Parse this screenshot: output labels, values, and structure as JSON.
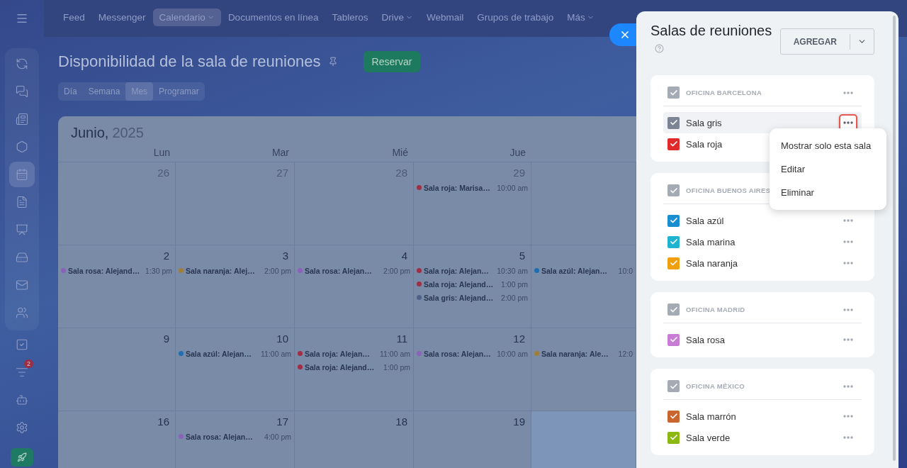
{
  "nav": {
    "items": [
      {
        "label": "Feed",
        "selected": false,
        "caret": false
      },
      {
        "label": "Messenger",
        "selected": false,
        "caret": false
      },
      {
        "label": "Calendario",
        "selected": true,
        "caret": true
      },
      {
        "label": "Documentos en línea",
        "selected": false,
        "caret": false
      },
      {
        "label": "Tableros",
        "selected": false,
        "caret": false
      },
      {
        "label": "Drive",
        "selected": false,
        "caret": true
      },
      {
        "label": "Webmail",
        "selected": false,
        "caret": false
      },
      {
        "label": "Grupos de trabajo",
        "selected": false,
        "caret": false
      },
      {
        "label": "Más",
        "selected": false,
        "caret": true
      }
    ]
  },
  "sidebar": {
    "grouped_items": [
      {
        "selected": false
      },
      {
        "selected": false
      },
      {
        "selected": false
      },
      {
        "selected": false
      },
      {
        "selected": true
      },
      {
        "selected": false
      },
      {
        "selected": false
      },
      {
        "selected": false
      },
      {
        "selected": false
      },
      {
        "selected": false
      }
    ],
    "items": [
      {
        "selected": false
      },
      {
        "selected": false,
        "badge": "2"
      },
      {
        "selected": false
      },
      {
        "selected": false
      }
    ]
  },
  "page": {
    "title": "Disponibilidad de la sala de reuniones",
    "action": "Reservar",
    "views": [
      {
        "label": "Día",
        "selected": false
      },
      {
        "label": "Semana",
        "selected": false
      },
      {
        "label": "Mes",
        "selected": true
      },
      {
        "label": "Programar",
        "selected": false
      }
    ]
  },
  "calendar": {
    "month": "Junio,",
    "year": "2025",
    "weekdays": [
      "Lun",
      "Mar",
      "Mié",
      "Jue"
    ],
    "weeks": [
      {
        "days": [
          {
            "day": "26",
            "other_month": true
          },
          {
            "day": "27",
            "other_month": true
          },
          {
            "day": "28",
            "other_month": true
          },
          {
            "day": "29",
            "other_month": true,
            "events": [
              {
                "label": "Sala roja: Marisa…",
                "time": "10:00 am",
                "color": "#9e2f45"
              }
            ]
          },
          {
            "today": false
          }
        ]
      },
      {
        "days": [
          {
            "day": "2",
            "other_month": false,
            "events": [
              {
                "label": "Sala rosa: Alejand…",
                "time": "1:30 pm",
                "color": "#8a63b8"
              }
            ]
          },
          {
            "day": "3",
            "other_month": false,
            "events": [
              {
                "label": "Sala naranja: Alej…",
                "time": "2:00 pm",
                "color": "#a07e3a"
              }
            ]
          },
          {
            "day": "4",
            "other_month": false,
            "events": [
              {
                "label": "Sala rosa: Alejan…",
                "time": "2:00 pm",
                "color": "#8a63b8"
              }
            ]
          },
          {
            "day": "5",
            "other_month": false,
            "events": [
              {
                "label": "Sala roja: Alejan…",
                "time": "10:30 am",
                "color": "#9e2f45"
              },
              {
                "label": "Sala roja: Alejand…",
                "time": "1:00 pm",
                "color": "#9e2f45"
              },
              {
                "label": "Sala gris: Alejand…",
                "time": "2:00 pm",
                "color": "#4f6188"
              }
            ]
          },
          {
            "today": false,
            "events": [
              {
                "label": "Sala azúl: Alejan…",
                "time": "10:0",
                "color": "#1f6fb0"
              }
            ]
          }
        ]
      },
      {
        "days": [
          {
            "day": "9",
            "other_month": false
          },
          {
            "day": "10",
            "other_month": false,
            "events": [
              {
                "label": "Sala azúl: Alejan…",
                "time": "11:00 am",
                "color": "#1f6fb0"
              }
            ]
          },
          {
            "day": "11",
            "other_month": false,
            "events": [
              {
                "label": "Sala roja: Alejan…",
                "time": "11:00 am",
                "color": "#9e2f45"
              },
              {
                "label": "Sala roja: Alejand…",
                "time": "1:00 pm",
                "color": "#9e2f45"
              }
            ]
          },
          {
            "day": "12",
            "other_month": false,
            "events": [
              {
                "label": "Sala rosa: Alejan…",
                "time": "10:00 am",
                "color": "#8a63b8"
              }
            ]
          },
          {
            "today": false,
            "events": [
              {
                "label": "Sala naranja: Ale…",
                "time": "12:0",
                "color": "#a07e3a"
              }
            ]
          }
        ]
      },
      {
        "days": [
          {
            "day": "16",
            "other_month": false
          },
          {
            "day": "17",
            "other_month": false,
            "events": [
              {
                "label": "Sala rosa: Alejan…",
                "time": "4:00 pm",
                "color": "#8a63b8"
              }
            ]
          },
          {
            "day": "18",
            "other_month": false
          },
          {
            "day": "19",
            "other_month": false
          },
          {
            "today": true
          }
        ]
      }
    ]
  },
  "panel": {
    "title": "Salas de reuniones",
    "add_button": "AGREGAR",
    "groups": [
      {
        "name": "OFICINA BARCELONA",
        "checked": true,
        "menu_button": true,
        "rooms": [
          {
            "name": "Sala gris",
            "color": "#7b8394",
            "checked": true,
            "selected": true,
            "menu_button": true
          },
          {
            "name": "Sala roja",
            "color": "#e0292b",
            "checked": true,
            "selected": false,
            "menu_button": false
          }
        ]
      },
      {
        "name": "OFICINA BUENOS AIRES",
        "checked": true,
        "menu_button": false,
        "rooms": [
          {
            "name": "Sala azúl",
            "color": "#1a8fd0",
            "checked": true,
            "selected": false,
            "menu_button": true
          },
          {
            "name": "Sala marina",
            "color": "#1eb4cf",
            "checked": true,
            "selected": false,
            "menu_button": true
          },
          {
            "name": "Sala naranja",
            "color": "#f0a00f",
            "checked": true,
            "selected": false,
            "menu_button": true
          }
        ]
      },
      {
        "name": "OFICINA MADRID",
        "checked": true,
        "menu_button": true,
        "rooms": [
          {
            "name": "Sala rosa",
            "color": "#c77dd4",
            "checked": true,
            "selected": false,
            "menu_button": true
          }
        ]
      },
      {
        "name": "OFICINA MÉXICO",
        "checked": true,
        "menu_button": true,
        "rooms": [
          {
            "name": "Sala marrón",
            "color": "#c9652f",
            "checked": true,
            "selected": false,
            "menu_button": true
          },
          {
            "name": "Sala verde",
            "color": "#8cb812",
            "checked": true,
            "selected": false,
            "menu_button": true
          }
        ]
      }
    ],
    "menu": [
      "Mostrar solo esta sala",
      "Editar",
      "Eliminar"
    ]
  }
}
